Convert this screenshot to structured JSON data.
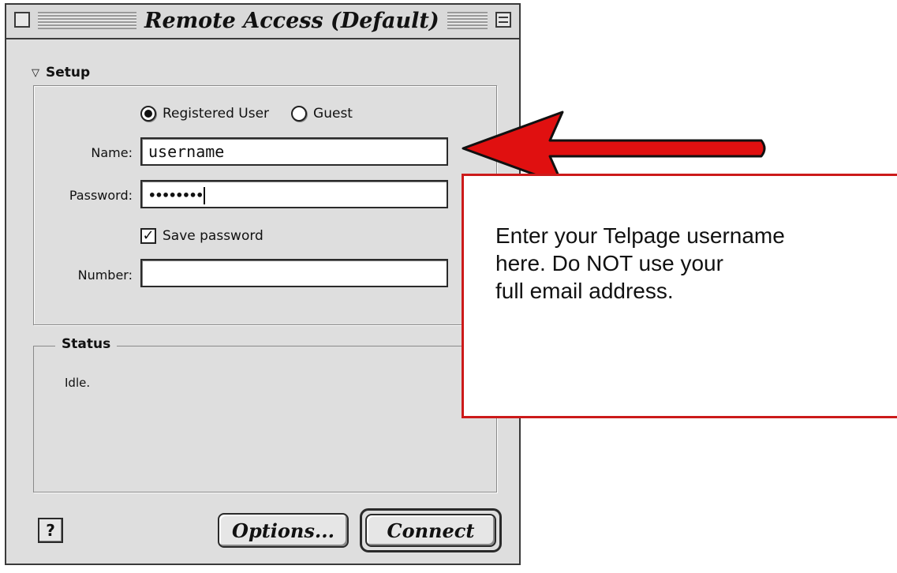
{
  "window": {
    "title": "Remote Access (Default)"
  },
  "setup": {
    "section_label": "Setup",
    "radio_options": [
      {
        "label": "Registered User",
        "selected": true
      },
      {
        "label": "Guest",
        "selected": false
      }
    ],
    "name_label": "Name:",
    "name_value": "username",
    "password_label": "Password:",
    "password_value": "••••••••",
    "save_password_label": "Save password",
    "save_password_checked": true,
    "number_label": "Number:",
    "number_value": ""
  },
  "status": {
    "section_label": "Status",
    "text": "Idle."
  },
  "buttons": {
    "help_icon": "question-mark-icon",
    "help_glyph": "?",
    "options_label": "Options...",
    "connect_label": "Connect"
  },
  "callout": {
    "text": "Enter your Telpage username\nhere. Do NOT use your\nfull email address.",
    "border_color": "#cc1a1a",
    "arrow_color": "#e01010"
  }
}
